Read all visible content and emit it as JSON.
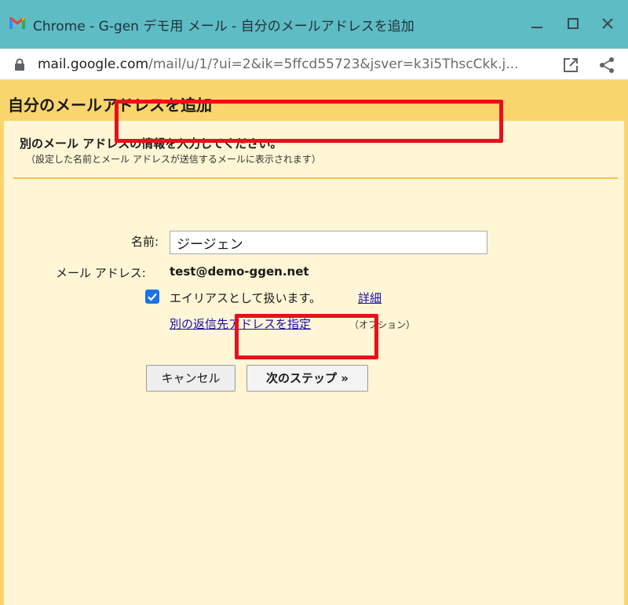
{
  "window": {
    "title": "Chrome - G-gen デモ用 メール - 自分のメールアドレスを追加",
    "url_host": "mail.google.com",
    "url_path": "/mail/u/1/?ui=2&ik=5ffcd55723&jsver=k3i5ThscCkk.j..."
  },
  "dialog": {
    "heading": "自分のメールアドレスを追加",
    "intro": "別のメール アドレスの情報を入力してください。",
    "intro_sub": "（設定した名前とメール アドレスが送信するメールに表示されます）",
    "name_label": "名前:",
    "name_value": "ジージェン",
    "email_label": "メール アドレス:",
    "email_value": "test@demo-ggen.net",
    "alias_checked": true,
    "alias_text": "エイリアスとして扱います。",
    "alias_link": "詳細",
    "reply_link": "別の返信先アドレスを指定",
    "reply_option": "（オプション）",
    "cancel_label": "キャンセル",
    "next_label": "次のステップ »"
  },
  "icons": {
    "app": "gmail-icon",
    "lock": "lock-icon",
    "open": "open-in-new-icon",
    "share": "share-icon"
  },
  "colors": {
    "titlebar": "#5ebcc5",
    "page_background": "#f9d56e",
    "panel_background": "#fff6d6",
    "highlight": "#e8101a",
    "link": "#1a0dab",
    "checkbox": "#1a73e8"
  }
}
